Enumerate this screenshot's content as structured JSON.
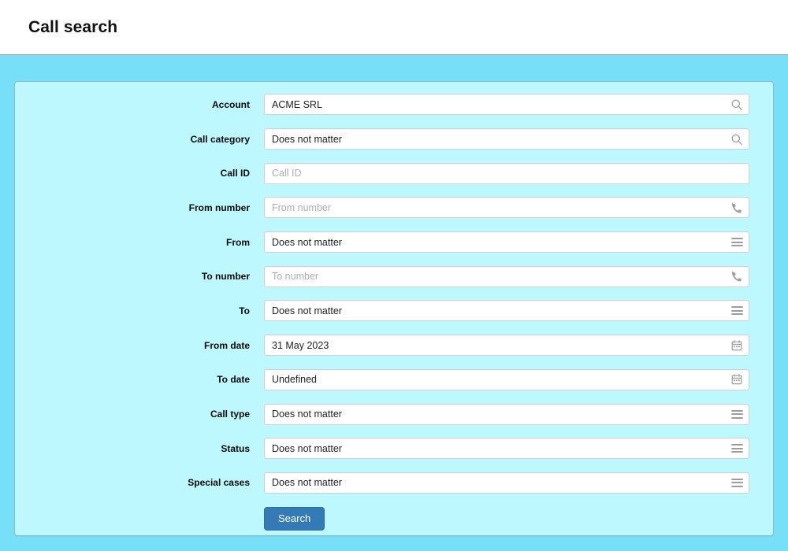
{
  "header": {
    "title": "Call search"
  },
  "theme": {
    "outer_background": "#77e0f8",
    "panel_background": "#bdf8ff",
    "panel_border": "#8fb9c4",
    "button_color": "#337ab7",
    "placeholder_color": "#adadad",
    "icon_color": "#9d9d9d"
  },
  "form": {
    "fields": [
      {
        "label": "Account",
        "value": "ACME SRL",
        "placeholder": "",
        "is_placeholder": false,
        "icon": "search-icon",
        "name": "account"
      },
      {
        "label": "Call category",
        "value": "Does not matter",
        "placeholder": "",
        "is_placeholder": false,
        "icon": "search-icon",
        "name": "call-category"
      },
      {
        "label": "Call ID",
        "value": "Call ID",
        "placeholder": "Call ID",
        "is_placeholder": true,
        "icon": "none",
        "name": "call-id"
      },
      {
        "label": "From number",
        "value": "From number",
        "placeholder": "From number",
        "is_placeholder": true,
        "icon": "phone-icon",
        "name": "from-number"
      },
      {
        "label": "From",
        "value": "Does not matter",
        "placeholder": "",
        "is_placeholder": false,
        "icon": "hamburger-icon",
        "name": "from"
      },
      {
        "label": "To number",
        "value": "To number",
        "placeholder": "To number",
        "is_placeholder": true,
        "icon": "phone-icon",
        "name": "to-number"
      },
      {
        "label": "To",
        "value": "Does not matter",
        "placeholder": "",
        "is_placeholder": false,
        "icon": "hamburger-icon",
        "name": "to"
      },
      {
        "label": "From date",
        "value": "31 May 2023",
        "placeholder": "",
        "is_placeholder": false,
        "icon": "calendar-icon",
        "name": "from-date"
      },
      {
        "label": "To date",
        "value": "Undefined",
        "placeholder": "",
        "is_placeholder": false,
        "icon": "calendar-icon",
        "name": "to-date"
      },
      {
        "label": "Call type",
        "value": "Does not matter",
        "placeholder": "",
        "is_placeholder": false,
        "icon": "hamburger-icon",
        "name": "call-type"
      },
      {
        "label": "Status",
        "value": "Does not matter",
        "placeholder": "",
        "is_placeholder": false,
        "icon": "hamburger-icon",
        "name": "status"
      },
      {
        "label": "Special cases",
        "value": "Does not matter",
        "placeholder": "",
        "is_placeholder": false,
        "icon": "hamburger-icon",
        "name": "special-cases"
      }
    ],
    "submit_label": "Search"
  }
}
